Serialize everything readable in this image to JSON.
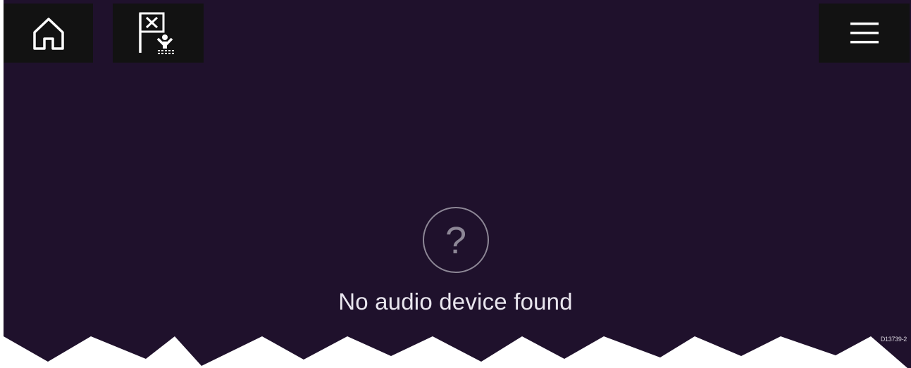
{
  "topbar": {
    "home_icon": "home-icon",
    "mob_icon": "man-overboard-icon",
    "menu_icon": "hamburger-menu-icon"
  },
  "status": {
    "icon": "question-mark-icon",
    "glyph": "?",
    "message": "No audio device found"
  },
  "doc_code": "D13739-2",
  "colors": {
    "background": "#1f112c",
    "button_background": "#121212",
    "icon": "#ffffff",
    "text": "#e9e6ee",
    "status_ring": "#8d8796"
  }
}
